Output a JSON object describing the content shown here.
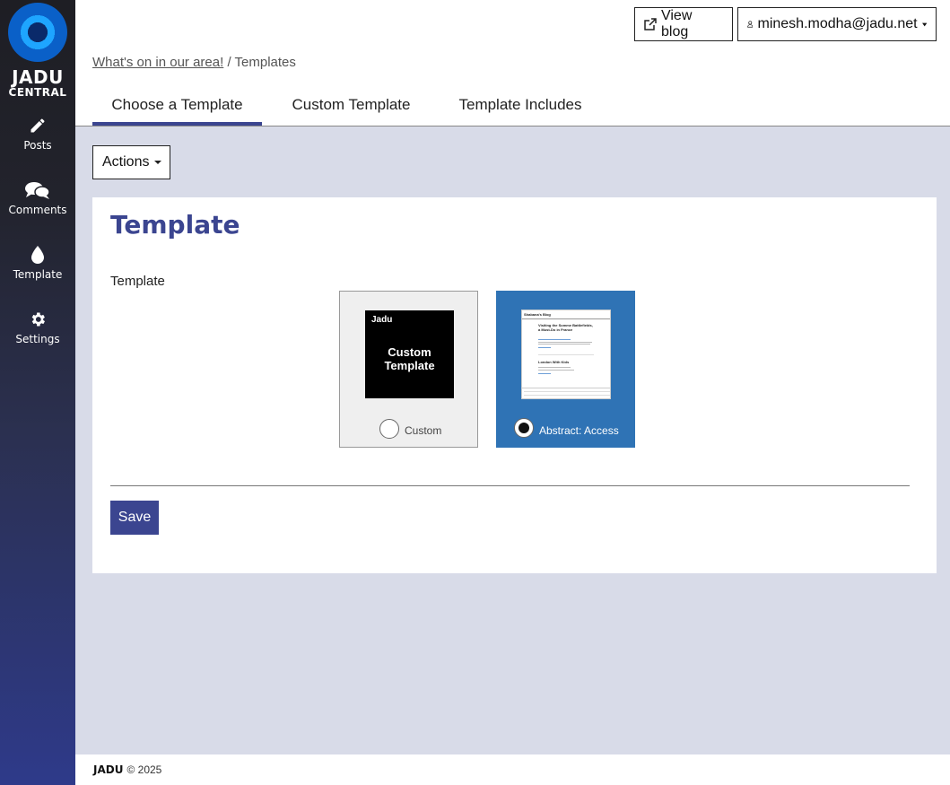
{
  "sidebar": {
    "logo_line1": "JADU",
    "logo_line2": "CENTRAL",
    "items": [
      {
        "label": "Posts",
        "icon": "pencil-icon"
      },
      {
        "label": "Comments",
        "icon": "comments-icon"
      },
      {
        "label": "Template",
        "icon": "droplet-icon"
      },
      {
        "label": "Settings",
        "icon": "gear-icon"
      }
    ]
  },
  "header": {
    "view_blog": "View blog",
    "user": "minesh.modha@jadu.net"
  },
  "breadcrumb": {
    "parent": "What's on in our area!",
    "separator": "/",
    "current": "Templates"
  },
  "tabs": [
    {
      "label": "Choose a Template",
      "active": true
    },
    {
      "label": "Custom Template",
      "active": false
    },
    {
      "label": "Template Includes",
      "active": false
    }
  ],
  "actions": {
    "label": "Actions"
  },
  "card": {
    "title": "Template",
    "field_label": "Template",
    "options": [
      {
        "label": "Custom",
        "selected": false,
        "thumb_brand": "Jadu",
        "thumb_text": "Custom Template"
      },
      {
        "label": "Abstract: Access",
        "selected": true,
        "thumb_header": "Shabana's Blog",
        "thumb_post1": "Visiting the Somme Battlefields, a Must-Do in France",
        "thumb_post2": "London With Kids"
      }
    ],
    "save_label": "Save"
  },
  "footer": {
    "brand": "JADU",
    "copyright": "© 2025"
  },
  "colors": {
    "accent": "#3b4590",
    "selected_tile": "#2f73b5",
    "content_bg": "#d8dbe8"
  }
}
